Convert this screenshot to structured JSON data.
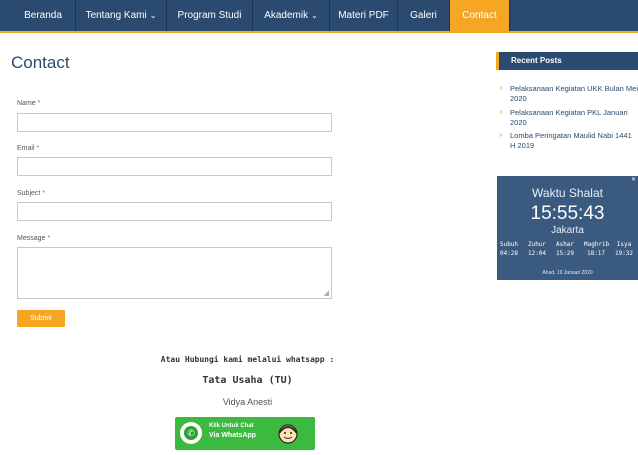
{
  "nav": {
    "items": [
      {
        "label": "Beranda",
        "dropdown": false
      },
      {
        "label": "Tentang Kami",
        "dropdown": true
      },
      {
        "label": "Program Studi",
        "dropdown": false
      },
      {
        "label": "Akademik",
        "dropdown": true
      },
      {
        "label": "Materi PDF",
        "dropdown": false
      },
      {
        "label": "Galeri",
        "dropdown": false
      },
      {
        "label": "Contact",
        "dropdown": false,
        "active": true
      }
    ],
    "chevron": "⌄"
  },
  "page": {
    "title": "Contact"
  },
  "form": {
    "name_label": "Name",
    "email_label": "Email",
    "subject_label": "Subject",
    "message_label": "Message",
    "required_mark": "*",
    "name_value": "",
    "email_value": "",
    "subject_value": "",
    "message_value": "",
    "submit_label": "Submit"
  },
  "whatsapp": {
    "intro": "Atau Hubungi kami melalui whatsapp :",
    "title": "Tata Usaha (TU)",
    "name": "Vidya Anesti",
    "button_line1": "Klik Untuk Chat",
    "button_line2": "Via WhatsApp"
  },
  "sidebar": {
    "recent_title": "Recent Posts",
    "posts": [
      "Pelaksanaan Kegiatan UKK Bulan Mei 2020",
      "Pelaksanaan Kegiatan PKL Januari 2020",
      "Lomba Peringatan Maulid Nabi 1441 H 2019"
    ],
    "post_arrow": "»"
  },
  "prayer": {
    "title": "Waktu Shalat",
    "time": "15:55:43",
    "city": "Jakarta",
    "times": [
      {
        "name": "Subuh",
        "time": "04:28"
      },
      {
        "name": "Zuhur",
        "time": "12:04"
      },
      {
        "name": "Ashar",
        "time": "15:29"
      },
      {
        "name": "Maghrib",
        "time": "18:17"
      },
      {
        "name": "Isya",
        "time": "19:32"
      }
    ],
    "date": "Ahad, 19 Januari 2020"
  },
  "colors": {
    "nav_bg": "#2b4a6f",
    "accent": "#f5a623",
    "whatsapp_green": "#3cb93f",
    "widget_bg": "#3b5a80"
  },
  "icons": {
    "post_bullet": "chevron-right-icon",
    "whatsapp": "whatsapp-icon",
    "resize": "resize-handle-icon"
  }
}
